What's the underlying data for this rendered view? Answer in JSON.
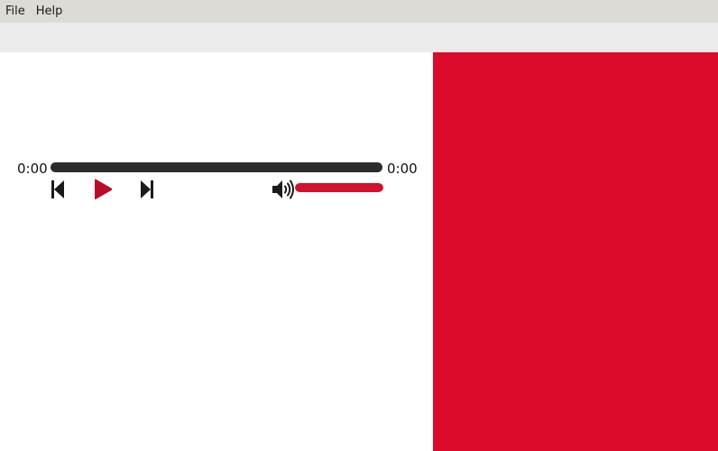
{
  "menubar": {
    "items": [
      {
        "label": "File"
      },
      {
        "label": "Help"
      }
    ]
  },
  "player": {
    "current_time": "0:00",
    "total_time": "0:00",
    "progress_fraction": 0.0,
    "volume_fraction": 1.0,
    "icons": {
      "previous": "skip-previous-icon",
      "play": "play-icon",
      "next": "skip-next-icon",
      "volume": "volume-high-icon"
    }
  },
  "colors": {
    "accent": "#dc0b2b",
    "play_icon": "#b80d27",
    "progress_track": "#2c2c2c",
    "menubar_bg": "#dcdbd6",
    "toolbar_bg": "#ebebeb"
  }
}
